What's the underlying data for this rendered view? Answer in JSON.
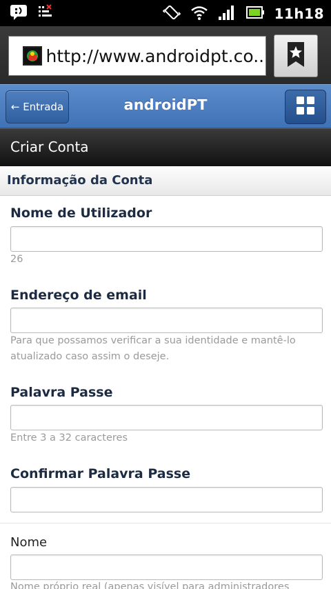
{
  "status_bar": {
    "time": "11h18",
    "icons": [
      "notification-icon",
      "usb-debug-icon",
      "vibrate-icon",
      "wifi-icon",
      "signal-icon",
      "battery-icon"
    ]
  },
  "browser": {
    "url": "http://www.androidpt.co...",
    "bookmark_icon": "bookmark-star-icon"
  },
  "site_header": {
    "back_label": "← Entrada",
    "title": "androidPT",
    "menu_icon": "grid-icon"
  },
  "page": {
    "title": "Criar Conta"
  },
  "section": {
    "title": "Informação da Conta"
  },
  "form": {
    "username": {
      "label": "Nome de Utilizador",
      "value": "",
      "hint": "26"
    },
    "email": {
      "label": "Endereço de email",
      "value": "",
      "hint": "Para que possamos verificar a sua identidade e mantê-lo atualizado caso assim o deseje."
    },
    "password": {
      "label": "Palavra Passe",
      "value": "",
      "hint": "Entre 3 a 32 caracteres"
    },
    "confirm_password": {
      "label": "Confirmar Palavra Passe",
      "value": ""
    },
    "name": {
      "label": "Nome",
      "value": "",
      "hint": "Nome próprio real (apenas visível para administradores"
    }
  },
  "colors": {
    "header_blue": "#4a7dc0",
    "label_navy": "#1d2b42",
    "hint_gray": "#9a9a9a"
  }
}
